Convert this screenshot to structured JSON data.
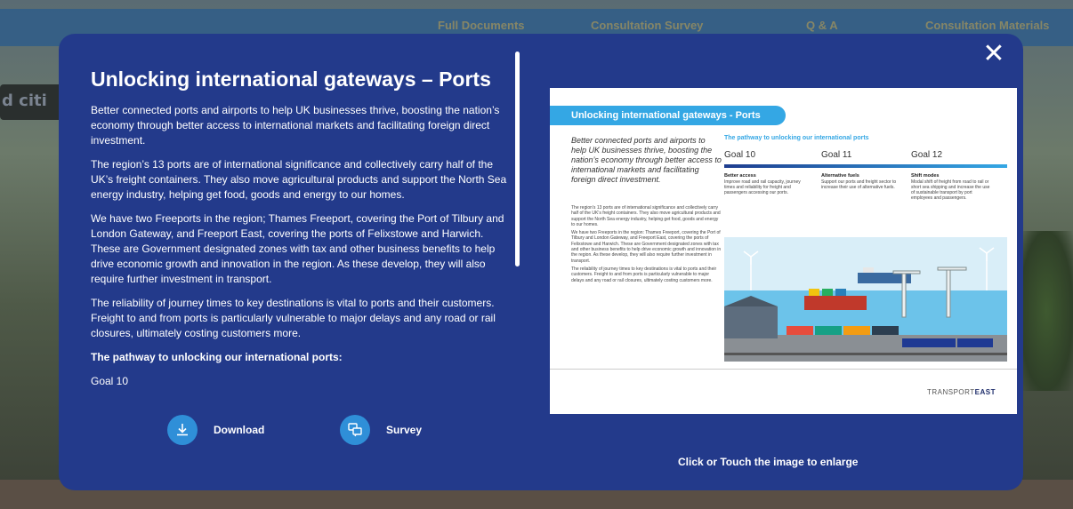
{
  "nav": {
    "items": [
      "Full Documents",
      "Consultation Survey",
      "Q & A",
      "Consultation Materials"
    ]
  },
  "background": {
    "sign_text": "d citi"
  },
  "modal": {
    "title": "Unlocking international gateways – Ports",
    "paragraphs": [
      "Better connected ports and airports to help UK businesses thrive, boosting the nation’s economy through better access to international markets and facilitating foreign direct investment.",
      "The region’s 13 ports are of international significance and collectively carry half of the UK’s freight containers. They also move agricultural products and support the North Sea energy industry, helping get food, goods and energy to our homes.",
      "We have two Freeports in the region; Thames Freeport, covering the Port of Tilbury and London Gateway, and Freeport East, covering the ports of Felixstowe and Harwich. These are Government designated zones with tax and other business benefits to help drive economic growth and innovation in the region. As these develop, they will also require further investment in transport.",
      "The reliability of journey times to key destinations is vital to ports and their customers. Freight to and from ports is particularly vulnerable to major delays and any road or rail closures, ultimately costing customers more."
    ],
    "subheading": "The pathway to unlocking our international ports:",
    "cutoff_text": "Goal 10",
    "download_label": "Download",
    "survey_label": "Survey",
    "close_label": "✕",
    "enlarge_caption": "Click or Touch the  image to enlarge"
  },
  "preview": {
    "banner": "Unlocking international gateways - Ports",
    "intro": "Better connected ports and airports to help UK businesses thrive, boosting the nation’s economy through better access to international markets and facilitating foreign direct investment.",
    "body": [
      "The region’s 13 ports are of international significance and collectively carry half of the UK’s freight containers. They also move agricultural products and support the North Sea energy industry, helping get food, goods and energy to our homes.",
      "We have two Freeports in the region: Thames Freeport, covering the Port of Tilbury and London Gateway, and Freeport East, covering the ports of Felixstowe and Harwich. These are Government designated zones with tax and other business benefits to help drive economic growth and innovation in the region. As these develop, they will also require further investment in transport.",
      "The reliability of journey times to key destinations is vital to ports and their customers. Freight to and from ports is particularly vulnerable to major delays and any road or rail closures, ultimately costing customers more."
    ],
    "pathway_title": "The pathway to unlocking our international ports",
    "goals": [
      {
        "label": "Goal 10",
        "title": "Better access",
        "text": "Improve road and rail capacity, journey times and reliability for freight and passengers accessing our ports."
      },
      {
        "label": "Goal 11",
        "title": "Alternative fuels",
        "text": "Support our ports and freight sector to increase their use of alternative fuels."
      },
      {
        "label": "Goal 12",
        "title": "Shift modes",
        "text": "Modal shift of freight from road to rail or short sea shipping and increase the use of sustainable transport by port employees and passengers."
      }
    ],
    "logo_prefix": "TRANSPORT",
    "logo_suffix": "EAST"
  },
  "colors": {
    "modal_bg": "#233a8b",
    "accent_blue": "#34a7e4",
    "icon_circle": "#2f8fd8"
  }
}
